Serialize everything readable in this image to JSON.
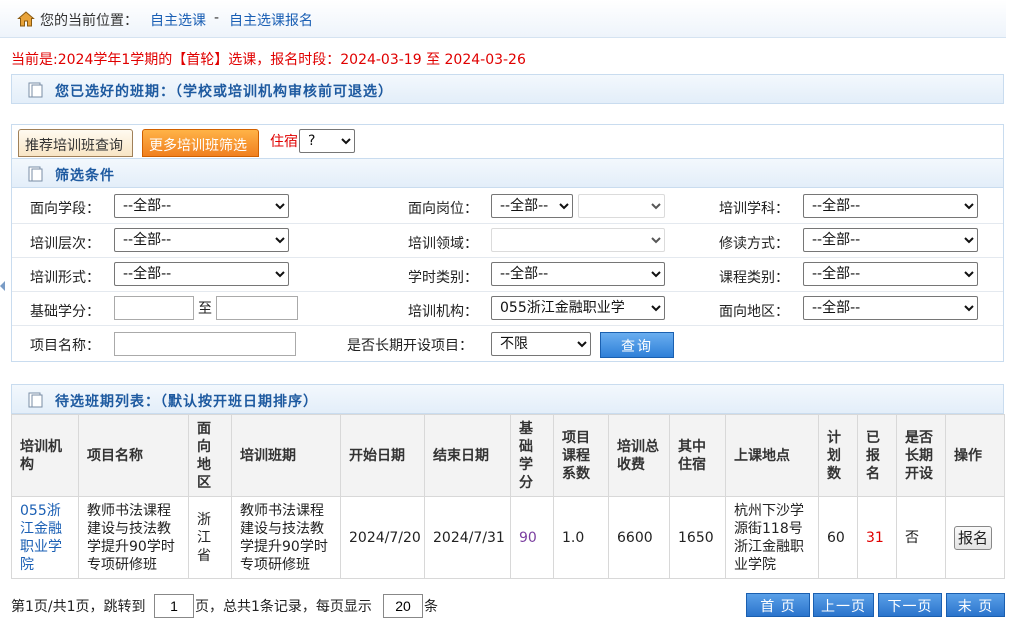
{
  "breadcrumb": {
    "label": "您的当前位置：",
    "items": [
      "自主选课",
      "自主选课报名"
    ],
    "separator": "-"
  },
  "notice": "当前是:2024学年1学期的【首轮】选课，报名时段：2024-03-19 至 2024-03-26",
  "selected_section": {
    "title": "您已选好的班期：（学校或培训机构审核前可退选）"
  },
  "tabs": [
    {
      "label": "推荐培训班查询",
      "active": false
    },
    {
      "label": "更多培训班筛选",
      "active": true
    }
  ],
  "stay": {
    "label": "住宿",
    "value": "?"
  },
  "filter_section": {
    "title": "筛选条件"
  },
  "filters": {
    "row1": [
      {
        "label": "面向学段：",
        "value": "--全部--"
      },
      {
        "label": "面向岗位：",
        "value": "--全部--",
        "extra_value": ""
      },
      {
        "label": "培训学科：",
        "value": "--全部--"
      }
    ],
    "row2": [
      {
        "label": "培训层次：",
        "value": "--全部--"
      },
      {
        "label": "培训领域：",
        "value": ""
      },
      {
        "label": "修读方式：",
        "value": "--全部--"
      }
    ],
    "row3": [
      {
        "label": "培训形式：",
        "value": "--全部--"
      },
      {
        "label": "学时类别：",
        "value": "--全部--"
      },
      {
        "label": "课程类别：",
        "value": "--全部--"
      }
    ],
    "row4": {
      "credit_label": "基础学分：",
      "credit_to": "至",
      "credit_from_value": "",
      "credit_to_value": "",
      "org_label": "培训机构：",
      "org_value": "055浙江金融职业学",
      "region_label": "面向地区：",
      "region_value": "--全部--"
    },
    "row5": {
      "name_label": "项目名称：",
      "name_value": "",
      "longterm_label": "是否长期开设项目：",
      "longterm_value": "不限",
      "query_button": "查询"
    }
  },
  "list_section": {
    "title": "待选班期列表：（默认按开班日期排序）"
  },
  "table": {
    "headers": [
      "培训机构",
      "项目名称",
      "面向地区",
      "培训班期",
      "开始日期",
      "结束日期",
      "基础学分",
      "项目课程系数",
      "培训总收费",
      "其中住宿",
      "上课地点",
      "计划数",
      "已报名",
      "是否长期开设",
      "操作"
    ],
    "rows": [
      {
        "org": "055浙江金融职业学院",
        "project": "教师书法课程建设与技法教学提升90学时专项研修班",
        "region": "浙江省",
        "term": "教师书法课程建设与技法教学提升90学时专项研修班",
        "start": "2024/7/20",
        "end": "2024/7/31",
        "credit": "90",
        "coef": "1.0",
        "fee": "6600",
        "lodging": "1650",
        "location": "杭州下沙学源街118号浙江金融职业学院",
        "plan": "60",
        "enrolled": "31",
        "longterm": "否",
        "action": "报名"
      }
    ]
  },
  "pagination": {
    "page_info": "第1页/共1页，跳转到",
    "page_input": "1",
    "summary": "页，总共1条记录，每页显示",
    "per_page": "20",
    "unit": "条",
    "buttons": [
      "首 页",
      "上一页",
      "下一页",
      "末 页"
    ]
  },
  "colors": {
    "accent": "#1e5aa0",
    "notice": "#e00000",
    "credit": "#7b3fa0",
    "enrolled": "#e00000"
  }
}
